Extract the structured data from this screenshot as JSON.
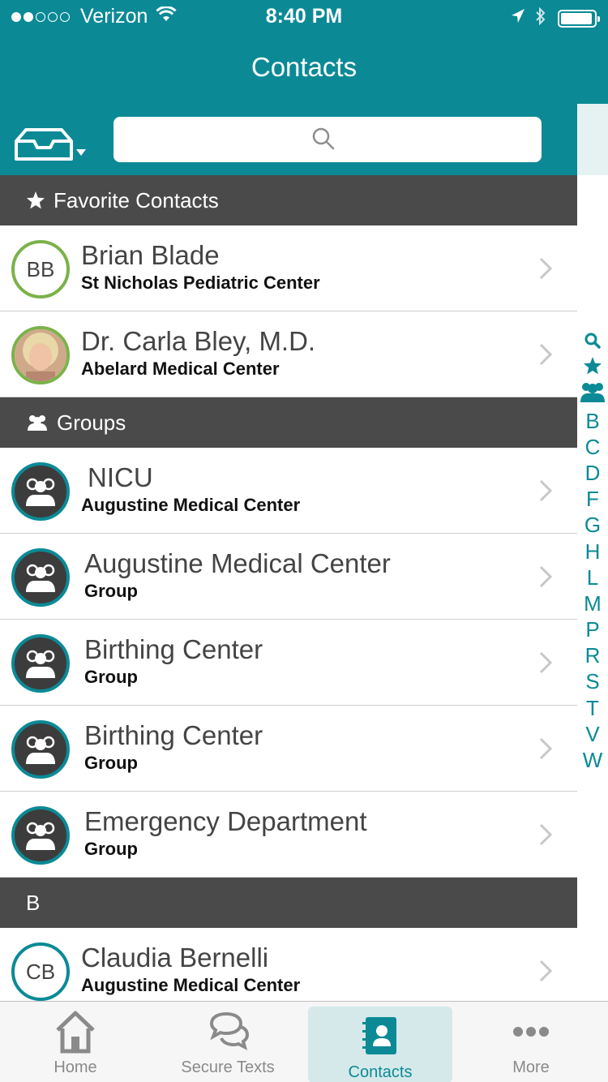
{
  "status_bar": {
    "carrier": "Verizon",
    "time": "8:40 PM"
  },
  "nav": {
    "title": "Contacts"
  },
  "search": {
    "placeholder": ""
  },
  "sections": {
    "favorites": "Favorite Contacts",
    "groups": "Groups",
    "b": "B"
  },
  "favorites": [
    {
      "initials": "BB",
      "name": "Brian Blade",
      "subtitle": "St Nicholas Pediatric Center"
    },
    {
      "initials": "",
      "name": "Dr. Carla Bley, M.D.",
      "subtitle": "Abelard Medical Center"
    }
  ],
  "groups": [
    {
      "name": "NICU",
      "subtitle": "Augustine Medical Center"
    },
    {
      "name": "Augustine Medical Center",
      "subtitle": "Group"
    },
    {
      "name": "Birthing Center",
      "subtitle": "Group"
    },
    {
      "name": "Birthing Center",
      "subtitle": "Group"
    },
    {
      "name": "Emergency Department",
      "subtitle": "Group"
    }
  ],
  "b_contacts": [
    {
      "initials": "CB",
      "name": "Claudia Bernelli",
      "subtitle": "Augustine Medical Center"
    }
  ],
  "index_letters": [
    "B",
    "C",
    "D",
    "F",
    "G",
    "H",
    "L",
    "M",
    "P",
    "R",
    "S",
    "T",
    "V",
    "W"
  ],
  "tabs": [
    {
      "label": "Home",
      "icon": "home-icon"
    },
    {
      "label": "Secure Texts",
      "icon": "chat-bubbles-icon"
    },
    {
      "label": "Contacts",
      "icon": "contacts-book-icon"
    },
    {
      "label": "More",
      "icon": "more-dots-icon"
    }
  ],
  "colors": {
    "brand": "#0b8a96",
    "header": "#4a4a4a",
    "favorite_ring": "#7bb24a"
  }
}
